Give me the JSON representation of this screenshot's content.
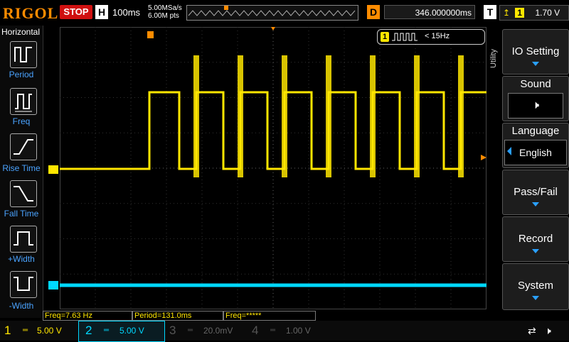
{
  "top": {
    "logo": "RIGOL",
    "run_state": "STOP",
    "horizontal_label": "H",
    "timebase": "100ms",
    "sample_rate": "5.00MSa/s",
    "mem_depth": "6.00M pts",
    "delay_label": "D",
    "delay_value": "346.000000ms",
    "trigger_label": "T",
    "trigger_channel": "1",
    "trigger_level": "1.70 V"
  },
  "left_menu": {
    "title": "Horizontal",
    "items": [
      {
        "label": "Period",
        "icon": "period-icon"
      },
      {
        "label": "Freq",
        "icon": "freq-icon"
      },
      {
        "label": "Rise Time",
        "icon": "rise-time-icon"
      },
      {
        "label": "Fall Time",
        "icon": "fall-time-icon"
      },
      {
        "label": "+Width",
        "icon": "pos-width-icon"
      },
      {
        "label": "-Width",
        "icon": "neg-width-icon"
      }
    ]
  },
  "right_menu": {
    "title": "Utility",
    "io": "IO Setting",
    "sound": "Sound",
    "language": "Language",
    "language_value": "English",
    "passfail": "Pass/Fail",
    "record": "Record",
    "system": "System"
  },
  "screen": {
    "freq_badge_channel": "1",
    "freq_badge_value": "< 15Hz",
    "ch1_marker": "1",
    "ch2_marker": "2"
  },
  "measurements": {
    "freq": "Freq=7.63 Hz",
    "period": "Period=131.0ms",
    "freq2": "Freq=*****"
  },
  "channels": [
    {
      "num": "1",
      "scale": "5.00 V",
      "color": "#ffe600"
    },
    {
      "num": "2",
      "scale": "5.00 V",
      "color": "#00d8ff"
    },
    {
      "num": "3",
      "scale": "20.0mV",
      "color": "#cc44ff"
    },
    {
      "num": "4",
      "scale": "1.00 V",
      "color": "#3366ff"
    }
  ],
  "colors": {
    "ch1": "#ffe600",
    "ch2": "#00d8ff",
    "accent": "#ff8c00"
  }
}
